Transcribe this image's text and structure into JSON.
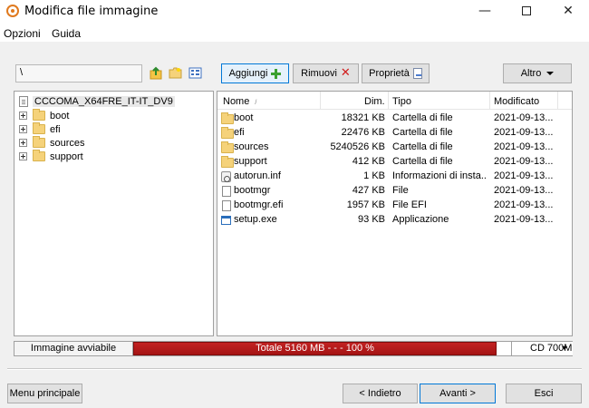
{
  "window": {
    "title": "Modifica file immagine",
    "minimize": "—",
    "close": "✕"
  },
  "menu": {
    "items": [
      "Opzioni",
      "Guida"
    ]
  },
  "toolbar": {
    "path_value": "\\",
    "add_label": "Aggiungi",
    "remove_label": "Rimuovi",
    "properties_label": "Proprietà",
    "other_label": "Altro"
  },
  "tree": {
    "root": "CCCOMA_X64FRE_IT-IT_DV9",
    "items": [
      {
        "label": "boot"
      },
      {
        "label": "efi"
      },
      {
        "label": "sources"
      },
      {
        "label": "support"
      }
    ]
  },
  "file_list": {
    "headers": {
      "name": "Nome",
      "size": "Dim.",
      "type": "Tipo",
      "modified": "Modificato"
    },
    "rows": [
      {
        "name": "boot",
        "size": "18321 KB",
        "type": "Cartella di file",
        "modified": "2021-09-13...",
        "icon": "folder-icon"
      },
      {
        "name": "efi",
        "size": "22476 KB",
        "type": "Cartella di file",
        "modified": "2021-09-13...",
        "icon": "folder-icon"
      },
      {
        "name": "sources",
        "size": "5240526 KB",
        "type": "Cartella di file",
        "modified": "2021-09-13...",
        "icon": "folder-icon"
      },
      {
        "name": "support",
        "size": "412 KB",
        "type": "Cartella di file",
        "modified": "2021-09-13...",
        "icon": "folder-icon"
      },
      {
        "name": "autorun.inf",
        "size": "1 KB",
        "type": "Informazioni di insta...",
        "modified": "2021-09-13...",
        "icon": "setup-info-icon"
      },
      {
        "name": "bootmgr",
        "size": "427 KB",
        "type": "File",
        "modified": "2021-09-13...",
        "icon": "file-icon"
      },
      {
        "name": "bootmgr.efi",
        "size": "1957 KB",
        "type": "File EFI",
        "modified": "2021-09-13...",
        "icon": "file-icon"
      },
      {
        "name": "setup.exe",
        "size": "93 KB",
        "type": "Applicazione",
        "modified": "2021-09-13...",
        "icon": "application-icon"
      }
    ]
  },
  "status": {
    "bootable_label": "Immagine avviabile",
    "total_text": "Totale 5160 MB  - - -  100 %",
    "progress_fraction": 1.0,
    "progress_color": "#b31b1b",
    "media_label": "CD 700M"
  },
  "buttons": {
    "main_menu": "Menu principale",
    "back": "< Indietro",
    "next": "Avanti >",
    "exit": "Esci"
  },
  "colors": {
    "accent": "#0078d7",
    "folder": "#f5d27a"
  }
}
